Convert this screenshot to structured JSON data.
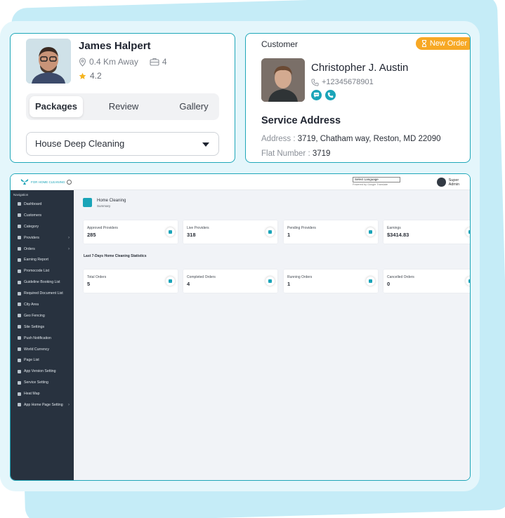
{
  "provider": {
    "name": "James Halpert",
    "distance": "0.4 Km Away",
    "jobs": "4",
    "rating": "4.2",
    "tabs": [
      {
        "label": "Packages"
      },
      {
        "label": "Review"
      },
      {
        "label": "Gallery"
      }
    ],
    "service_select": "House Deep Cleaning"
  },
  "customer": {
    "section_label": "Customer",
    "badge": "New Order",
    "name": "Christopher J. Austin",
    "phone": "+12345678901",
    "service_address_title": "Service Address",
    "address_key": "Address : ",
    "address_value": "3719, Chatham way, Reston, MD 22090",
    "flat_key": "Flat Number : ",
    "flat_value": "3719"
  },
  "dashboard": {
    "brand": "FOR HOME CLEANING",
    "language_select": "Select Language",
    "powered_by": "Powered by Google Translate",
    "user": "Super Admin",
    "nav_heading": "Navigation",
    "nav": [
      {
        "label": "Dashboard",
        "chevron": ""
      },
      {
        "label": "Customers",
        "chevron": ""
      },
      {
        "label": "Category",
        "chevron": ""
      },
      {
        "label": "Providers",
        "chevron": "›"
      },
      {
        "label": "Orders",
        "chevron": "›"
      },
      {
        "label": "Earning Report",
        "chevron": ""
      },
      {
        "label": "Promocode List",
        "chevron": ""
      },
      {
        "label": "Guideline Booking List",
        "chevron": ""
      },
      {
        "label": "Required Document List",
        "chevron": ""
      },
      {
        "label": "City Area",
        "chevron": ""
      },
      {
        "label": "Geo Fencing",
        "chevron": ""
      },
      {
        "label": "Site Settings",
        "chevron": ""
      },
      {
        "label": "Push Notification",
        "chevron": ""
      },
      {
        "label": "World Currency",
        "chevron": ""
      },
      {
        "label": "Page List",
        "chevron": ""
      },
      {
        "label": "App Version Setting",
        "chevron": ""
      },
      {
        "label": "Service Setting",
        "chevron": ""
      },
      {
        "label": "Heat Map",
        "chevron": ""
      },
      {
        "label": "App Home Page Setting",
        "chevron": "›"
      }
    ],
    "page_title": "Home Cleaning",
    "page_subtitle": "Summary",
    "stats_top": [
      {
        "label": "Approved Providers",
        "value": "285"
      },
      {
        "label": "Live Providers",
        "value": "318"
      },
      {
        "label": "Pending Providers",
        "value": "1"
      },
      {
        "label": "Earnings",
        "value": "$3414.83"
      }
    ],
    "stats_section_title": "Last 7-Days Home Cleaning Statistics",
    "stats_bottom": [
      {
        "label": "Total Orders",
        "value": "5"
      },
      {
        "label": "Completed Orders",
        "value": "4"
      },
      {
        "label": "Running Orders",
        "value": "1"
      },
      {
        "label": "Cancelled Orders",
        "value": "0"
      }
    ]
  },
  "colors": {
    "accent": "#1aa4b8",
    "badge": "#f7a824",
    "sidebar": "#28323f"
  }
}
